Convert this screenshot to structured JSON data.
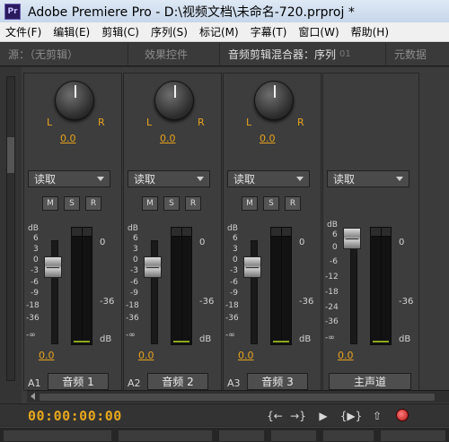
{
  "window": {
    "title": "Adobe Premiere Pro - D:\\视频文档\\未命名-720.prproj *",
    "app_icon": "Pr"
  },
  "menu": [
    "文件(F)",
    "编辑(E)",
    "剪辑(C)",
    "序列(S)",
    "标记(M)",
    "字幕(T)",
    "窗口(W)",
    "帮助(H)"
  ],
  "tabs": [
    {
      "label": "源：（无剪辑）",
      "active": false
    },
    {
      "label": "效果控件",
      "active": false
    },
    {
      "label": "音频剪辑混合器：序列",
      "suffix": "01",
      "active": true
    },
    {
      "label": "元数据",
      "active": false
    }
  ],
  "scale_left": [
    "dB",
    "6",
    "3",
    "0",
    "-3",
    "-6",
    "-9",
    "-18",
    "-36",
    "-∞"
  ],
  "scale_left_master": [
    "dB",
    "6",
    "0",
    "-6",
    "-12",
    "-18",
    "-24",
    "-36",
    "-∞"
  ],
  "scale_right": [
    "0",
    "-36",
    "dB"
  ],
  "channels": [
    {
      "id": "A1",
      "name": "音频 1",
      "pan_left": "L",
      "pan_right": "R",
      "pan": "0.0",
      "mode": "读取",
      "m": "M",
      "s": "S",
      "r": "R",
      "volume": "0.0"
    },
    {
      "id": "A2",
      "name": "音频 2",
      "pan_left": "L",
      "pan_right": "R",
      "pan": "0.0",
      "mode": "读取",
      "m": "M",
      "s": "S",
      "r": "R",
      "volume": "0.0"
    },
    {
      "id": "A3",
      "name": "音频 3",
      "pan_left": "L",
      "pan_right": "R",
      "pan": "0.0",
      "mode": "读取",
      "m": "M",
      "s": "S",
      "r": "R",
      "volume": "0.0"
    }
  ],
  "master": {
    "name": "主声道",
    "mode": "读取",
    "volume": "0.0"
  },
  "footer": {
    "timecode": "00:00:00:00",
    "controls": [
      "{←",
      "→}",
      "▶",
      "{▶}",
      "⇧",
      "●"
    ]
  },
  "colors": {
    "accent": "#e7a31d",
    "meter_floor": "#8aa81d"
  },
  "icons": [
    "premiere-app-icon",
    "pan-knob",
    "dropdown-arrow-icon",
    "go-to-in-icon",
    "go-to-out-icon",
    "play-icon",
    "play-in-to-out-icon",
    "loop-icon",
    "record-icon"
  ]
}
